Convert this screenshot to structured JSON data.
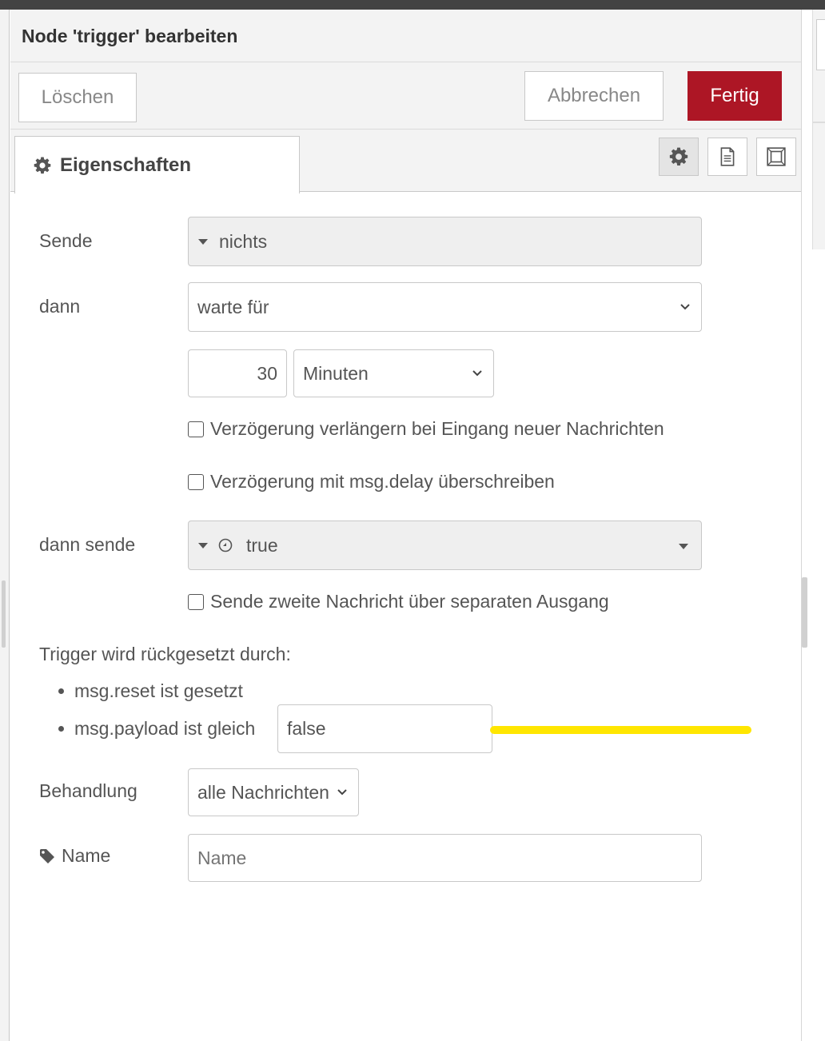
{
  "dialog": {
    "title": "Node 'trigger' bearbeiten",
    "buttons": {
      "delete": "Löschen",
      "cancel": "Abbrechen",
      "done": "Fertig"
    },
    "tab": {
      "label": "Eigenschaften",
      "icon": "gear-icon"
    },
    "tab_icons": [
      "gear-icon",
      "document-icon",
      "layout-frame-icon"
    ]
  },
  "form": {
    "send": {
      "label": "Sende",
      "value": "nichts"
    },
    "then": {
      "label": "dann",
      "value": "warte für"
    },
    "delay": {
      "amount": "30",
      "unit": "Minuten"
    },
    "extend_checkbox": {
      "label": "Verzögerung verlängern bei Eingang neuer Nachrichten",
      "checked": false
    },
    "override_checkbox": {
      "label": "Verzögerung mit msg.delay überschreiben",
      "checked": false
    },
    "then_send": {
      "label": "dann sende",
      "type_icon": "boolean-toggle-icon",
      "value": "true"
    },
    "second_output_checkbox": {
      "label": "Sende zweite Nachricht über separaten Ausgang",
      "checked": false
    },
    "reset": {
      "heading": "Trigger wird rückgesetzt durch:",
      "item1": "msg.reset ist gesetzt",
      "item2": "msg.payload ist gleich",
      "payload_value": "false"
    },
    "handling": {
      "label": "Behandlung",
      "value": "alle Nachrichten"
    },
    "name": {
      "label": "Name",
      "icon": "tag-icon",
      "placeholder": "Name",
      "value": ""
    }
  },
  "colors": {
    "primary": "#ad1625",
    "highlight": "#ffe600"
  }
}
